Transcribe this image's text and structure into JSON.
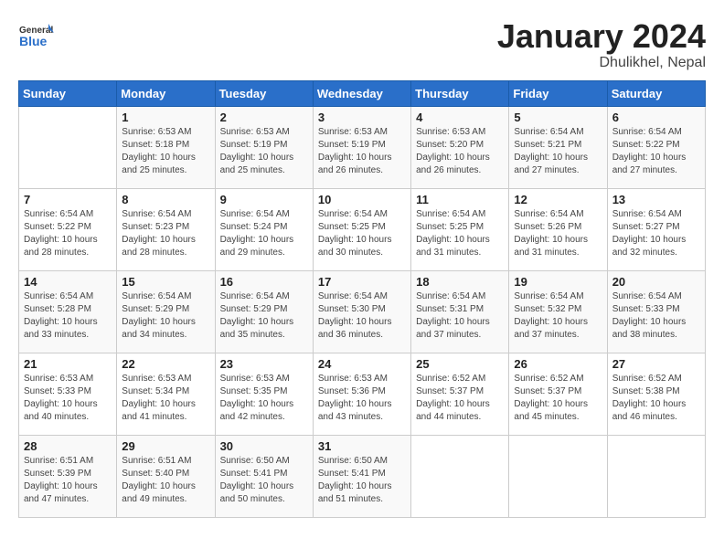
{
  "logo": {
    "general": "General",
    "blue": "Blue"
  },
  "title": "January 2024",
  "location": "Dhulikhel, Nepal",
  "days_of_week": [
    "Sunday",
    "Monday",
    "Tuesday",
    "Wednesday",
    "Thursday",
    "Friday",
    "Saturday"
  ],
  "weeks": [
    [
      {
        "day": "",
        "info": ""
      },
      {
        "day": "1",
        "info": "Sunrise: 6:53 AM\nSunset: 5:18 PM\nDaylight: 10 hours\nand 25 minutes."
      },
      {
        "day": "2",
        "info": "Sunrise: 6:53 AM\nSunset: 5:19 PM\nDaylight: 10 hours\nand 25 minutes."
      },
      {
        "day": "3",
        "info": "Sunrise: 6:53 AM\nSunset: 5:19 PM\nDaylight: 10 hours\nand 26 minutes."
      },
      {
        "day": "4",
        "info": "Sunrise: 6:53 AM\nSunset: 5:20 PM\nDaylight: 10 hours\nand 26 minutes."
      },
      {
        "day": "5",
        "info": "Sunrise: 6:54 AM\nSunset: 5:21 PM\nDaylight: 10 hours\nand 27 minutes."
      },
      {
        "day": "6",
        "info": "Sunrise: 6:54 AM\nSunset: 5:22 PM\nDaylight: 10 hours\nand 27 minutes."
      }
    ],
    [
      {
        "day": "7",
        "info": "Sunrise: 6:54 AM\nSunset: 5:22 PM\nDaylight: 10 hours\nand 28 minutes."
      },
      {
        "day": "8",
        "info": "Sunrise: 6:54 AM\nSunset: 5:23 PM\nDaylight: 10 hours\nand 28 minutes."
      },
      {
        "day": "9",
        "info": "Sunrise: 6:54 AM\nSunset: 5:24 PM\nDaylight: 10 hours\nand 29 minutes."
      },
      {
        "day": "10",
        "info": "Sunrise: 6:54 AM\nSunset: 5:25 PM\nDaylight: 10 hours\nand 30 minutes."
      },
      {
        "day": "11",
        "info": "Sunrise: 6:54 AM\nSunset: 5:25 PM\nDaylight: 10 hours\nand 31 minutes."
      },
      {
        "day": "12",
        "info": "Sunrise: 6:54 AM\nSunset: 5:26 PM\nDaylight: 10 hours\nand 31 minutes."
      },
      {
        "day": "13",
        "info": "Sunrise: 6:54 AM\nSunset: 5:27 PM\nDaylight: 10 hours\nand 32 minutes."
      }
    ],
    [
      {
        "day": "14",
        "info": "Sunrise: 6:54 AM\nSunset: 5:28 PM\nDaylight: 10 hours\nand 33 minutes."
      },
      {
        "day": "15",
        "info": "Sunrise: 6:54 AM\nSunset: 5:29 PM\nDaylight: 10 hours\nand 34 minutes."
      },
      {
        "day": "16",
        "info": "Sunrise: 6:54 AM\nSunset: 5:29 PM\nDaylight: 10 hours\nand 35 minutes."
      },
      {
        "day": "17",
        "info": "Sunrise: 6:54 AM\nSunset: 5:30 PM\nDaylight: 10 hours\nand 36 minutes."
      },
      {
        "day": "18",
        "info": "Sunrise: 6:54 AM\nSunset: 5:31 PM\nDaylight: 10 hours\nand 37 minutes."
      },
      {
        "day": "19",
        "info": "Sunrise: 6:54 AM\nSunset: 5:32 PM\nDaylight: 10 hours\nand 37 minutes."
      },
      {
        "day": "20",
        "info": "Sunrise: 6:54 AM\nSunset: 5:33 PM\nDaylight: 10 hours\nand 38 minutes."
      }
    ],
    [
      {
        "day": "21",
        "info": "Sunrise: 6:53 AM\nSunset: 5:33 PM\nDaylight: 10 hours\nand 40 minutes."
      },
      {
        "day": "22",
        "info": "Sunrise: 6:53 AM\nSunset: 5:34 PM\nDaylight: 10 hours\nand 41 minutes."
      },
      {
        "day": "23",
        "info": "Sunrise: 6:53 AM\nSunset: 5:35 PM\nDaylight: 10 hours\nand 42 minutes."
      },
      {
        "day": "24",
        "info": "Sunrise: 6:53 AM\nSunset: 5:36 PM\nDaylight: 10 hours\nand 43 minutes."
      },
      {
        "day": "25",
        "info": "Sunrise: 6:52 AM\nSunset: 5:37 PM\nDaylight: 10 hours\nand 44 minutes."
      },
      {
        "day": "26",
        "info": "Sunrise: 6:52 AM\nSunset: 5:37 PM\nDaylight: 10 hours\nand 45 minutes."
      },
      {
        "day": "27",
        "info": "Sunrise: 6:52 AM\nSunset: 5:38 PM\nDaylight: 10 hours\nand 46 minutes."
      }
    ],
    [
      {
        "day": "28",
        "info": "Sunrise: 6:51 AM\nSunset: 5:39 PM\nDaylight: 10 hours\nand 47 minutes."
      },
      {
        "day": "29",
        "info": "Sunrise: 6:51 AM\nSunset: 5:40 PM\nDaylight: 10 hours\nand 49 minutes."
      },
      {
        "day": "30",
        "info": "Sunrise: 6:50 AM\nSunset: 5:41 PM\nDaylight: 10 hours\nand 50 minutes."
      },
      {
        "day": "31",
        "info": "Sunrise: 6:50 AM\nSunset: 5:41 PM\nDaylight: 10 hours\nand 51 minutes."
      },
      {
        "day": "",
        "info": ""
      },
      {
        "day": "",
        "info": ""
      },
      {
        "day": "",
        "info": ""
      }
    ]
  ]
}
